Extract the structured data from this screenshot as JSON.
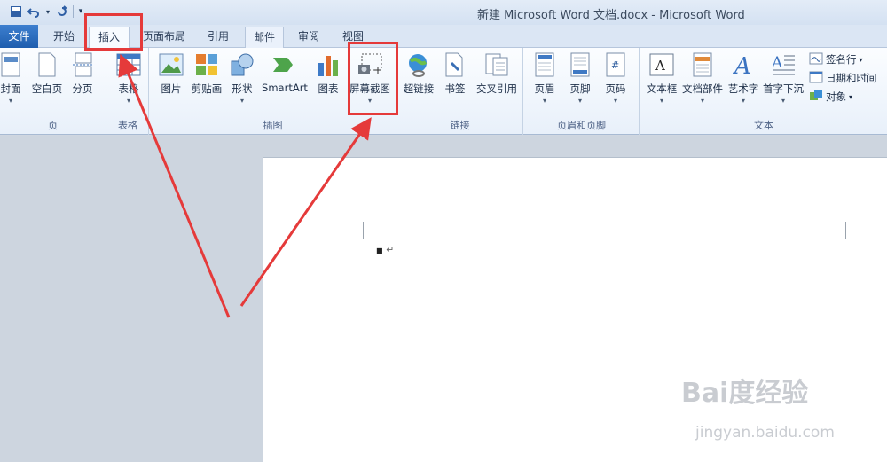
{
  "window": {
    "title": "新建 Microsoft Word 文档.docx - Microsoft Word"
  },
  "tabs": {
    "file": "文件",
    "home": "开始",
    "insert": "插入",
    "layout": "页面布局",
    "references": "引用",
    "mailings": "邮件",
    "review": "审阅",
    "view": "视图"
  },
  "ribbon": {
    "pages": {
      "label": "页",
      "cover": "封面",
      "blank": "空白页",
      "break": "分页"
    },
    "tables": {
      "label": "表格",
      "table": "表格"
    },
    "illustrations": {
      "label": "插图",
      "picture": "图片",
      "clipart": "剪贴画",
      "shapes": "形状",
      "smartart": "SmartArt",
      "chart": "图表",
      "screenshot": "屏幕截图"
    },
    "links": {
      "label": "链接",
      "hyperlink": "超链接",
      "bookmark": "书签",
      "crossref": "交叉引用"
    },
    "headerfooter": {
      "label": "页眉和页脚",
      "header": "页眉",
      "footer": "页脚",
      "pagenum": "页码"
    },
    "text": {
      "label": "文本",
      "textbox": "文本框",
      "quickparts": "文档部件",
      "wordart": "艺术字",
      "dropcap": "首字下沉",
      "signature": "签名行",
      "datetime": "日期和时间",
      "object": "对象"
    }
  },
  "document": {
    "para_mark": "↵"
  },
  "watermark": {
    "brand": "Bai度经验",
    "url": "jingyan.baidu.com"
  },
  "colors": {
    "highlight": "#e53a3a",
    "file_tab": "#2a67b8"
  }
}
